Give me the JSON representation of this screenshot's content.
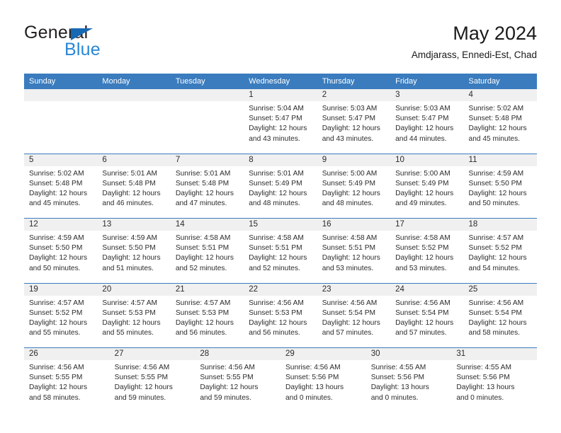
{
  "brand": {
    "name_top": "General",
    "name_bottom": "Blue",
    "triangle_icon": "triangle-icon",
    "color_dark": "#231f20",
    "color_blue": "#2a86d4"
  },
  "header": {
    "title": "May 2024",
    "subtitle": "Amdjarass, Ennedi-Est, Chad"
  },
  "theme": {
    "header_bar": "#3a7cbe",
    "daynum_band": "#f0f0f0",
    "text": "#2b2b2b"
  },
  "weekdays": [
    "Sunday",
    "Monday",
    "Tuesday",
    "Wednesday",
    "Thursday",
    "Friday",
    "Saturday"
  ],
  "weeks": [
    [
      {
        "day": "",
        "lines": []
      },
      {
        "day": "",
        "lines": []
      },
      {
        "day": "",
        "lines": []
      },
      {
        "day": "1",
        "lines": [
          "Sunrise: 5:04 AM",
          "Sunset: 5:47 PM",
          "Daylight: 12 hours",
          "and 43 minutes."
        ]
      },
      {
        "day": "2",
        "lines": [
          "Sunrise: 5:03 AM",
          "Sunset: 5:47 PM",
          "Daylight: 12 hours",
          "and 43 minutes."
        ]
      },
      {
        "day": "3",
        "lines": [
          "Sunrise: 5:03 AM",
          "Sunset: 5:47 PM",
          "Daylight: 12 hours",
          "and 44 minutes."
        ]
      },
      {
        "day": "4",
        "lines": [
          "Sunrise: 5:02 AM",
          "Sunset: 5:48 PM",
          "Daylight: 12 hours",
          "and 45 minutes."
        ]
      }
    ],
    [
      {
        "day": "5",
        "lines": [
          "Sunrise: 5:02 AM",
          "Sunset: 5:48 PM",
          "Daylight: 12 hours",
          "and 45 minutes."
        ]
      },
      {
        "day": "6",
        "lines": [
          "Sunrise: 5:01 AM",
          "Sunset: 5:48 PM",
          "Daylight: 12 hours",
          "and 46 minutes."
        ]
      },
      {
        "day": "7",
        "lines": [
          "Sunrise: 5:01 AM",
          "Sunset: 5:48 PM",
          "Daylight: 12 hours",
          "and 47 minutes."
        ]
      },
      {
        "day": "8",
        "lines": [
          "Sunrise: 5:01 AM",
          "Sunset: 5:49 PM",
          "Daylight: 12 hours",
          "and 48 minutes."
        ]
      },
      {
        "day": "9",
        "lines": [
          "Sunrise: 5:00 AM",
          "Sunset: 5:49 PM",
          "Daylight: 12 hours",
          "and 48 minutes."
        ]
      },
      {
        "day": "10",
        "lines": [
          "Sunrise: 5:00 AM",
          "Sunset: 5:49 PM",
          "Daylight: 12 hours",
          "and 49 minutes."
        ]
      },
      {
        "day": "11",
        "lines": [
          "Sunrise: 4:59 AM",
          "Sunset: 5:50 PM",
          "Daylight: 12 hours",
          "and 50 minutes."
        ]
      }
    ],
    [
      {
        "day": "12",
        "lines": [
          "Sunrise: 4:59 AM",
          "Sunset: 5:50 PM",
          "Daylight: 12 hours",
          "and 50 minutes."
        ]
      },
      {
        "day": "13",
        "lines": [
          "Sunrise: 4:59 AM",
          "Sunset: 5:50 PM",
          "Daylight: 12 hours",
          "and 51 minutes."
        ]
      },
      {
        "day": "14",
        "lines": [
          "Sunrise: 4:58 AM",
          "Sunset: 5:51 PM",
          "Daylight: 12 hours",
          "and 52 minutes."
        ]
      },
      {
        "day": "15",
        "lines": [
          "Sunrise: 4:58 AM",
          "Sunset: 5:51 PM",
          "Daylight: 12 hours",
          "and 52 minutes."
        ]
      },
      {
        "day": "16",
        "lines": [
          "Sunrise: 4:58 AM",
          "Sunset: 5:51 PM",
          "Daylight: 12 hours",
          "and 53 minutes."
        ]
      },
      {
        "day": "17",
        "lines": [
          "Sunrise: 4:58 AM",
          "Sunset: 5:52 PM",
          "Daylight: 12 hours",
          "and 53 minutes."
        ]
      },
      {
        "day": "18",
        "lines": [
          "Sunrise: 4:57 AM",
          "Sunset: 5:52 PM",
          "Daylight: 12 hours",
          "and 54 minutes."
        ]
      }
    ],
    [
      {
        "day": "19",
        "lines": [
          "Sunrise: 4:57 AM",
          "Sunset: 5:52 PM",
          "Daylight: 12 hours",
          "and 55 minutes."
        ]
      },
      {
        "day": "20",
        "lines": [
          "Sunrise: 4:57 AM",
          "Sunset: 5:53 PM",
          "Daylight: 12 hours",
          "and 55 minutes."
        ]
      },
      {
        "day": "21",
        "lines": [
          "Sunrise: 4:57 AM",
          "Sunset: 5:53 PM",
          "Daylight: 12 hours",
          "and 56 minutes."
        ]
      },
      {
        "day": "22",
        "lines": [
          "Sunrise: 4:56 AM",
          "Sunset: 5:53 PM",
          "Daylight: 12 hours",
          "and 56 minutes."
        ]
      },
      {
        "day": "23",
        "lines": [
          "Sunrise: 4:56 AM",
          "Sunset: 5:54 PM",
          "Daylight: 12 hours",
          "and 57 minutes."
        ]
      },
      {
        "day": "24",
        "lines": [
          "Sunrise: 4:56 AM",
          "Sunset: 5:54 PM",
          "Daylight: 12 hours",
          "and 57 minutes."
        ]
      },
      {
        "day": "25",
        "lines": [
          "Sunrise: 4:56 AM",
          "Sunset: 5:54 PM",
          "Daylight: 12 hours",
          "and 58 minutes."
        ]
      }
    ],
    [
      {
        "day": "26",
        "lines": [
          "Sunrise: 4:56 AM",
          "Sunset: 5:55 PM",
          "Daylight: 12 hours",
          "and 58 minutes."
        ]
      },
      {
        "day": "27",
        "lines": [
          "Sunrise: 4:56 AM",
          "Sunset: 5:55 PM",
          "Daylight: 12 hours",
          "and 59 minutes."
        ]
      },
      {
        "day": "28",
        "lines": [
          "Sunrise: 4:56 AM",
          "Sunset: 5:55 PM",
          "Daylight: 12 hours",
          "and 59 minutes."
        ]
      },
      {
        "day": "29",
        "lines": [
          "Sunrise: 4:56 AM",
          "Sunset: 5:56 PM",
          "Daylight: 13 hours",
          "and 0 minutes."
        ]
      },
      {
        "day": "30",
        "lines": [
          "Sunrise: 4:55 AM",
          "Sunset: 5:56 PM",
          "Daylight: 13 hours",
          "and 0 minutes."
        ]
      },
      {
        "day": "31",
        "lines": [
          "Sunrise: 4:55 AM",
          "Sunset: 5:56 PM",
          "Daylight: 13 hours",
          "and 0 minutes."
        ]
      }
    ]
  ]
}
